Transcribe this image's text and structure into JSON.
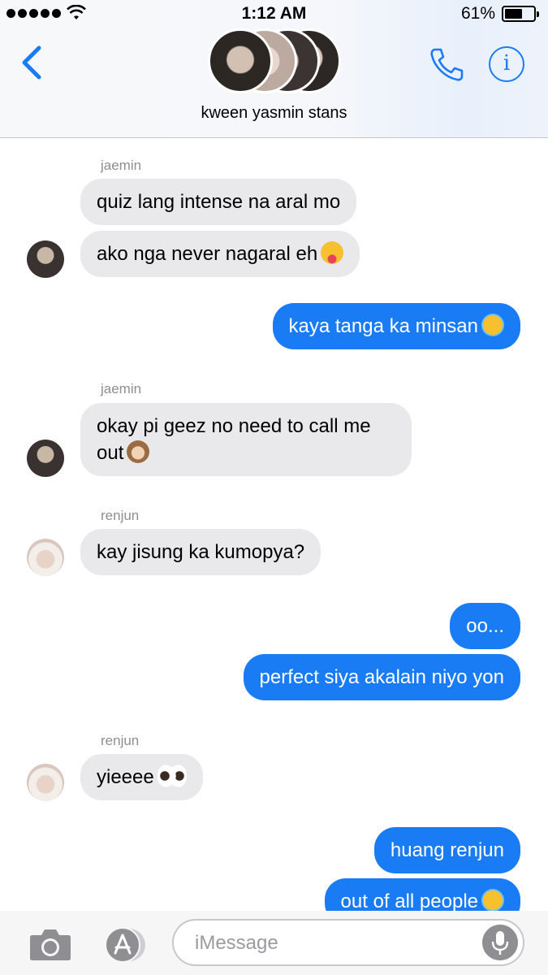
{
  "status_bar": {
    "time": "1:12 AM",
    "battery_percent": "61%",
    "battery_level": 0.61
  },
  "header": {
    "group_name": "kween yasmin stans",
    "back_icon": "chevron-left-icon",
    "call_icon": "phone-icon",
    "info_icon": "info-icon",
    "info_glyph": "i"
  },
  "messages": [
    {
      "direction": "incoming",
      "sender": "jaemin",
      "text": "quiz lang intense na aral mo"
    },
    {
      "direction": "incoming",
      "sender": "jaemin",
      "text": "ako nga never nagaral eh",
      "emoji": "squinting-tongue-emoji"
    },
    {
      "direction": "outgoing",
      "text": "kaya tanga ka minsan",
      "emoji": "loudly-crying-emoji"
    },
    {
      "direction": "incoming",
      "sender": "jaemin",
      "text": "okay pi geez no need to call me out",
      "emoji": "see-no-evil-monkey-emoji"
    },
    {
      "direction": "incoming",
      "sender": "renjun",
      "text": "kay jisung ka kumopya?"
    },
    {
      "direction": "outgoing",
      "text": "oo..."
    },
    {
      "direction": "outgoing",
      "text": "perfect siya akalain niyo yon"
    },
    {
      "direction": "incoming",
      "sender": "renjun",
      "text": "yieeee",
      "emoji": "eyes-emoji"
    },
    {
      "direction": "outgoing",
      "text": "huang renjun"
    },
    {
      "direction": "outgoing",
      "text": "out of all people",
      "emoji": "loudly-crying-emoji"
    }
  ],
  "input_bar": {
    "placeholder": "iMessage",
    "camera_icon": "camera-icon",
    "apps_icon": "app-store-icon",
    "mic_icon": "microphone-icon"
  },
  "colors": {
    "outgoing_bubble": "#1a7cf5",
    "incoming_bubble": "#e9e9eb",
    "accent": "#1a7cf5"
  }
}
